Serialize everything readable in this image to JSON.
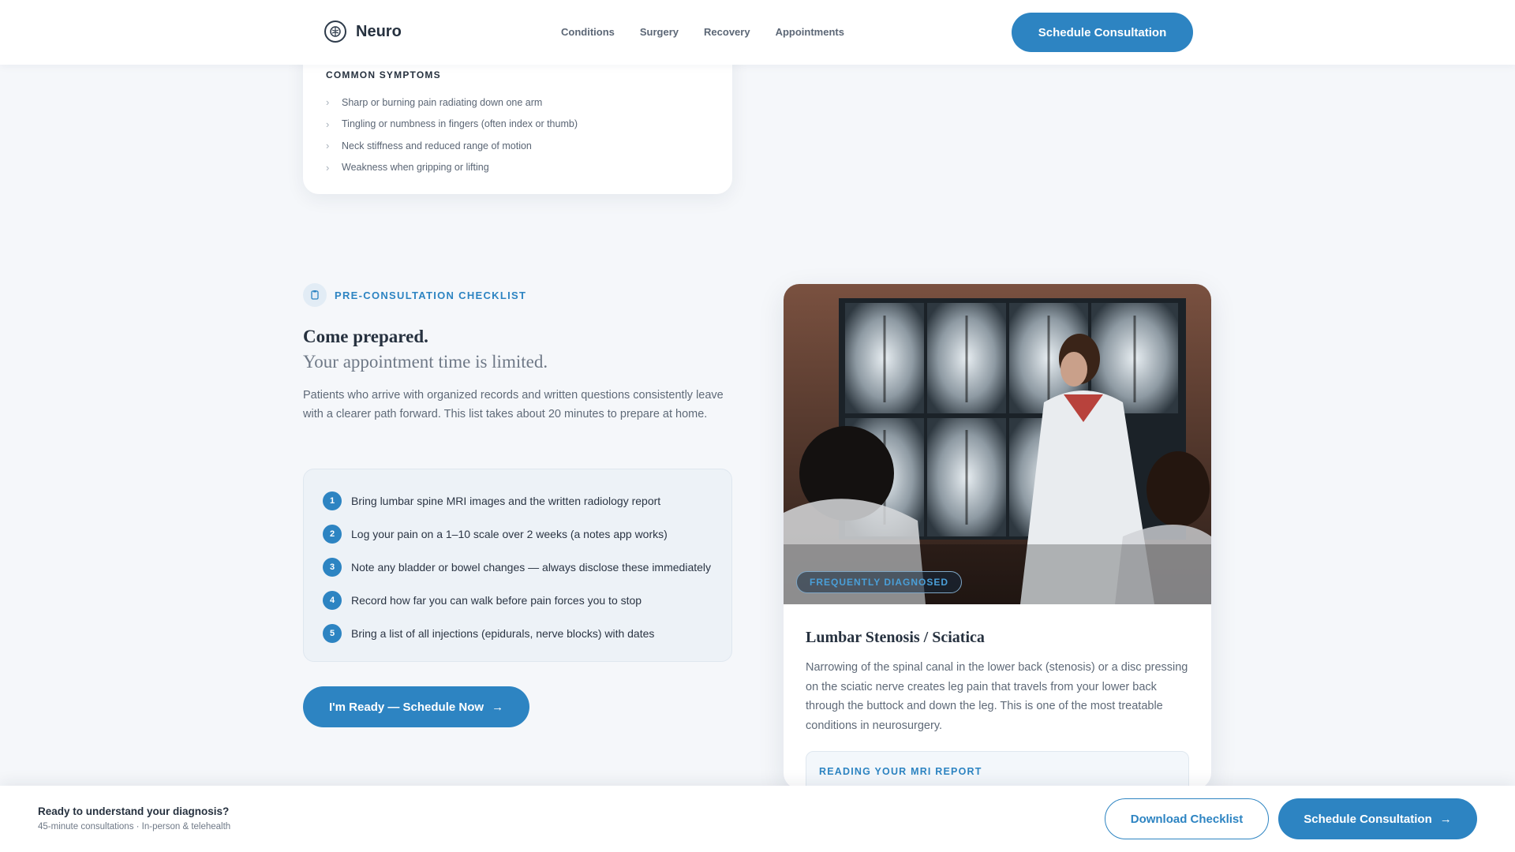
{
  "header": {
    "brand": "Neuro",
    "nav": [
      "Conditions",
      "Surgery",
      "Recovery",
      "Appointments"
    ],
    "cta": "Schedule Consultation"
  },
  "symptoms": {
    "title": "COMMON SYMPTOMS",
    "items": [
      "Sharp or burning pain radiating down one arm",
      "Tingling or numbness in fingers (often index or thumb)",
      "Neck stiffness and reduced range of motion",
      "Weakness when gripping or lifting"
    ]
  },
  "checklist_section": {
    "eyebrow": "PRE-CONSULTATION CHECKLIST",
    "headline": "Come prepared.",
    "subhead": "Your appointment time is limited.",
    "intro": "Patients who arrive with organized records and written questions consistently leave with a clearer path forward. This list takes about 20 minutes to prepare at home.",
    "items": [
      {
        "num": "1",
        "text": "Bring lumbar spine MRI images and the written radiology report"
      },
      {
        "num": "2",
        "text": "Log your pain on a 1–10 scale over 2 weeks (a notes app works)"
      },
      {
        "num": "3",
        "text": "Note any bladder or bowel changes — always disclose these immediately"
      },
      {
        "num": "4",
        "text": "Record how far you can walk before pain forces you to stop"
      },
      {
        "num": "5",
        "text": "Bring a list of all injections (epidurals, nerve blocks) with dates"
      }
    ],
    "cta": "I'm Ready — Schedule Now"
  },
  "condition_card": {
    "badge": "FREQUENTLY DIAGNOSED",
    "title": "Lumbar Stenosis / Sciatica",
    "description": "Narrowing of the spinal canal in the lower back (stenosis) or a disc pressing on the sciatic nerve creates leg pain that travels from your lower back through the buttock and down the leg. This is one of the most treatable conditions in neurosurgery.",
    "mri_label": "READING YOUR MRI REPORT"
  },
  "bottom_bar": {
    "title": "Ready to understand your diagnosis?",
    "subtitle": "45-minute consultations · In-person & telehealth",
    "secondary": "Download Checklist",
    "primary": "Schedule Consultation"
  },
  "colors": {
    "accent": "#2d84c2",
    "background": "#f5f7fa",
    "text": "#26313f"
  }
}
